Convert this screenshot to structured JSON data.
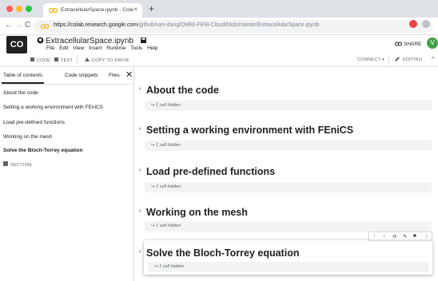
{
  "browser": {
    "tab_title": "ExtracellularSpace.ipynb - Cola",
    "tab_close": "×",
    "new_tab": "+",
    "back": "←",
    "forward": "→",
    "reload": "C",
    "url_main": "https://colab.research.google.com",
    "url_rest": "/github/van-dang/DMRI-FEM-Cloud/blob/master/ExtracellularSpace.ipynb",
    "colors": {
      "close_dot": "#ff5f57",
      "min_dot": "#febc2e",
      "max_dot": "#28c840",
      "colab_orange": "#f9ab00",
      "ext_red": "#e8453c"
    }
  },
  "colab": {
    "logo": "CO",
    "notebook_title": "ExtracellularSpace.ipynb",
    "menu": [
      "File",
      "Edit",
      "View",
      "Insert",
      "Runtime",
      "Tools",
      "Help"
    ],
    "share_label": "SHARE",
    "avatar_letter": "V",
    "avatar_color": "#43a047"
  },
  "toolbar": {
    "code_label": "CODE",
    "text_label": "TEXT",
    "copy_label": "COPY TO DRIVE",
    "connect_label": "CONNECT",
    "connect_caret": "▾",
    "editing_label": "EDITING",
    "collapse_caret": "^"
  },
  "sidebar": {
    "tabs": [
      "Table of contents",
      "Code snippets",
      "Files"
    ],
    "close": "✕",
    "toc": [
      "About the code",
      "Setting a working environment with FEniCS",
      "Load pre-defined functions",
      "Working on the mesh",
      "Solve the Bloch-Torrey equation"
    ],
    "section_label": "SECTION"
  },
  "notebook": {
    "arrow": "›",
    "hidden_label": "↪ 1 cell hidden",
    "sections": [
      "About the code",
      "Setting a working environment with FEniCS",
      "Load pre-defined functions",
      "Working on the mesh",
      "Solve the Bloch-Torrey equation"
    ],
    "cell_tools": [
      "↑",
      "↓",
      "⊖",
      "✎",
      "■",
      "⋮"
    ]
  }
}
